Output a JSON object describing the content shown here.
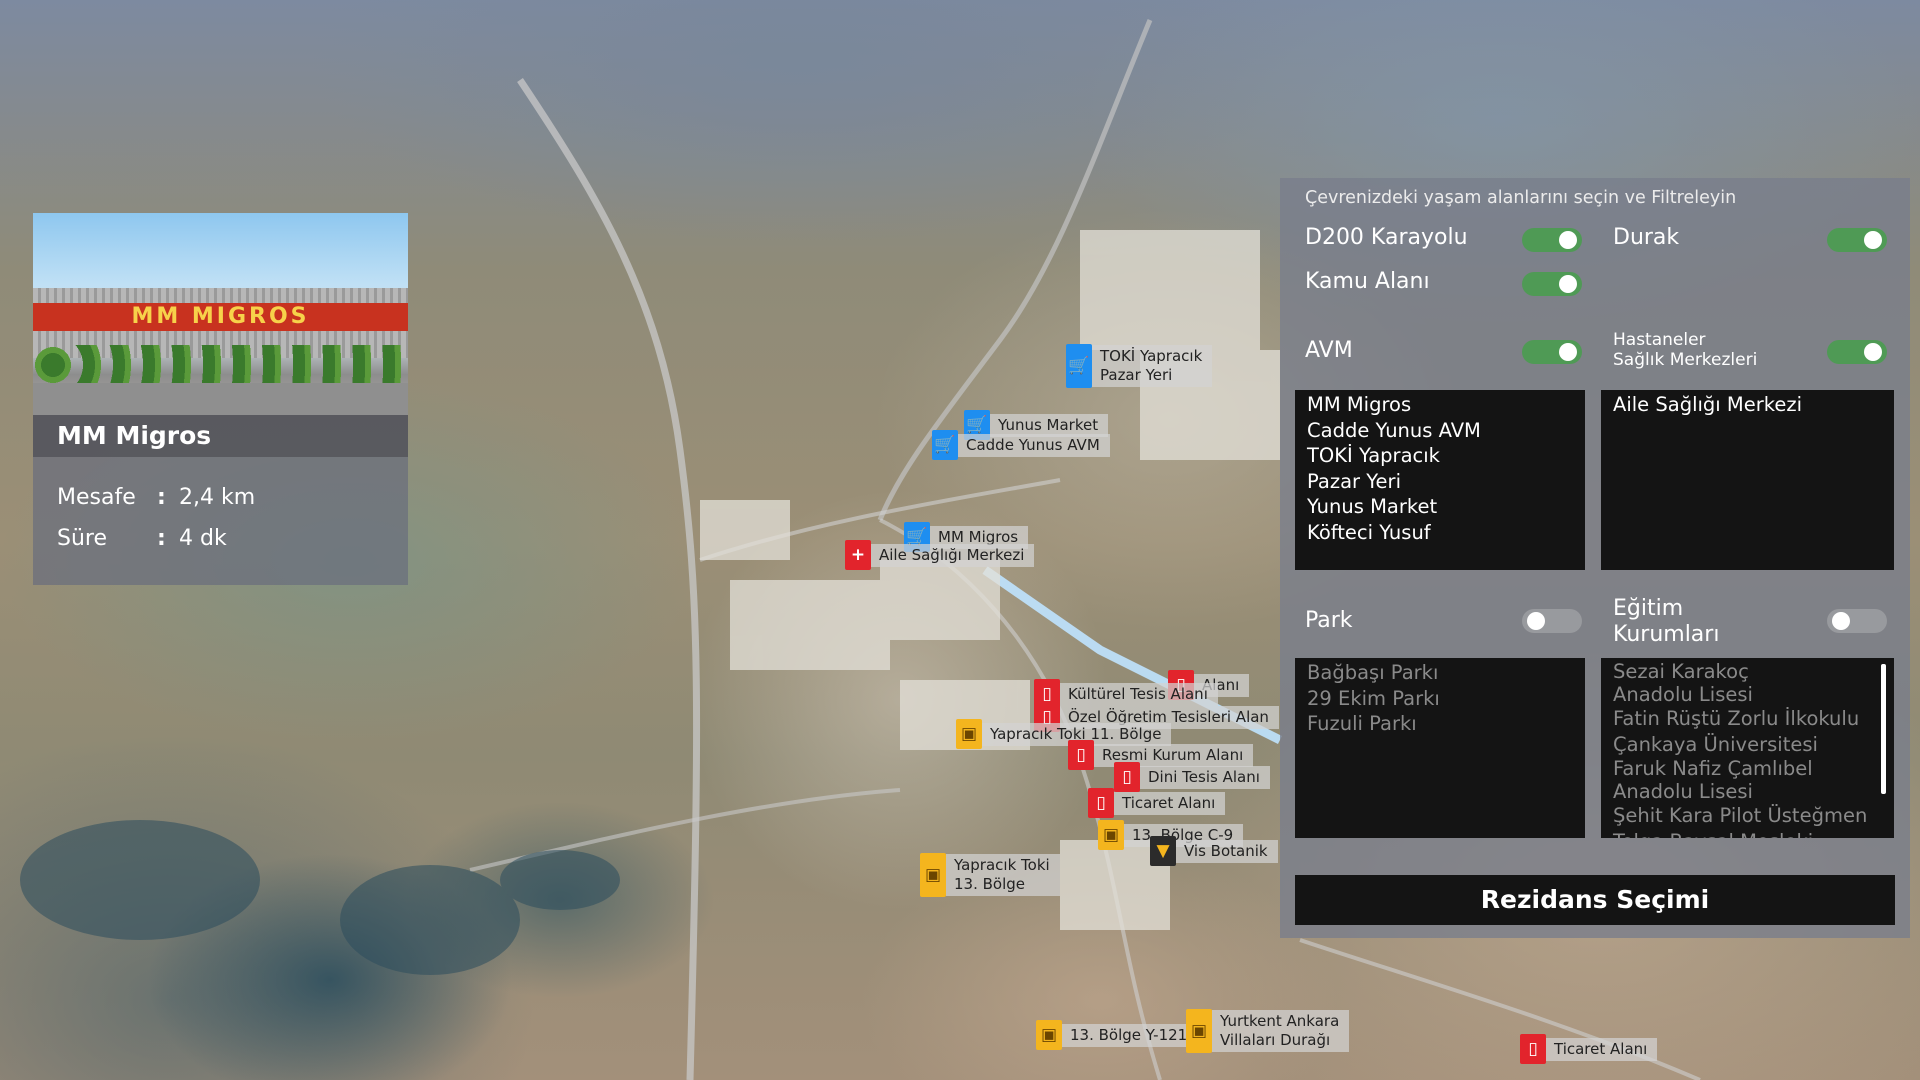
{
  "map": {
    "markers": [
      {
        "icon": "cart-icon",
        "color": "blue",
        "label": "TOKİ Yapracık\nPazar Yeri"
      },
      {
        "icon": "cart-icon",
        "color": "blue",
        "label": "Yunus Market"
      },
      {
        "icon": "cart-icon",
        "color": "blue",
        "label": "Cadde Yunus AVM"
      },
      {
        "icon": "cart-icon",
        "color": "blue",
        "label": "MM Migros"
      },
      {
        "icon": "hospital-icon",
        "color": "red",
        "label": "Aile Sağlığı Merkezi"
      },
      {
        "icon": "map-icon",
        "color": "red",
        "label": "Alanı"
      },
      {
        "icon": "map-icon",
        "color": "red",
        "label": "Kültürel Tesis Alanı"
      },
      {
        "icon": "map-icon",
        "color": "red",
        "label": "Özel Öğretim Tesisleri Alan"
      },
      {
        "icon": "bus-icon",
        "color": "yellow",
        "label": "Yapracık Toki 11. Bölge"
      },
      {
        "icon": "map-icon",
        "color": "red",
        "label": "Resmi Kurum Alanı"
      },
      {
        "icon": "map-icon",
        "color": "red",
        "label": "Dini Tesis Alanı"
      },
      {
        "icon": "map-icon",
        "color": "red",
        "label": "Ticaret Alanı"
      },
      {
        "icon": "bus-icon",
        "color": "yellow",
        "label": "13. Bölge C-9"
      },
      {
        "icon": "park-icon",
        "color": "dark",
        "label": "Vis Botanik"
      },
      {
        "icon": "bus-icon",
        "color": "yellow",
        "label": "Yapracık Toki\n13. Bölge"
      },
      {
        "icon": "bus-icon",
        "color": "yellow",
        "label": "13. Bölge Y-121"
      },
      {
        "icon": "bus-icon",
        "color": "yellow",
        "label": "Yurtkent Ankara\nVillaları Durağı"
      },
      {
        "icon": "map-icon",
        "color": "red",
        "label": "Ticaret Alanı"
      }
    ]
  },
  "info_card": {
    "photo_sign": "MM MIGROS",
    "title": "MM Migros",
    "distance_label": "Mesafe",
    "distance_value": "2,4 km",
    "duration_label": "Süre",
    "duration_value": "4 dk",
    "separator": ":"
  },
  "filter_panel": {
    "subtitle": "Çevrenizdeki yaşam alanlarını seçin ve Filtreleyin",
    "d200": {
      "label": "D200 Karayolu",
      "on": true
    },
    "durak": {
      "label": "Durak",
      "on": true
    },
    "kamu": {
      "label": "Kamu Alanı",
      "on": true
    },
    "avm": {
      "label": "AVM",
      "on": true,
      "items": [
        "MM Migros",
        "Cadde Yunus AVM",
        "TOKİ Yapracık",
        "Pazar Yeri",
        "Yunus Market",
        "Köfteci Yusuf"
      ]
    },
    "hastane": {
      "label_line1": "Hastaneler",
      "label_line2": "Sağlık Merkezleri",
      "on": true,
      "items": [
        "Aile Sağlığı Merkezi"
      ]
    },
    "park": {
      "label": "Park",
      "on": false,
      "items": [
        "Bağbaşı Parkı",
        "29 Ekim Parkı",
        "Fuzuli Parkı"
      ]
    },
    "egitim": {
      "label_line1": "Eğitim",
      "label_line2": "Kurumları",
      "on": false,
      "items": [
        "Sezai Karakoç",
        "Anadolu Lisesi",
        "Fatin Rüştü Zorlu İlkokulu",
        "Çankaya Üniversitesi",
        "Faruk Nafiz Çamlıbel",
        "Anadolu Lisesi",
        "Şehit Kara Pilot Üsteğmen",
        "Tolga Baysal Mesleki"
      ]
    },
    "residence_button": "Rezidans Seçimi"
  },
  "colors": {
    "marker_blue": "#1e8ef0",
    "marker_red": "#e2242c",
    "marker_yellow": "#f4b51e",
    "toggle_on": "#4f9a55"
  }
}
